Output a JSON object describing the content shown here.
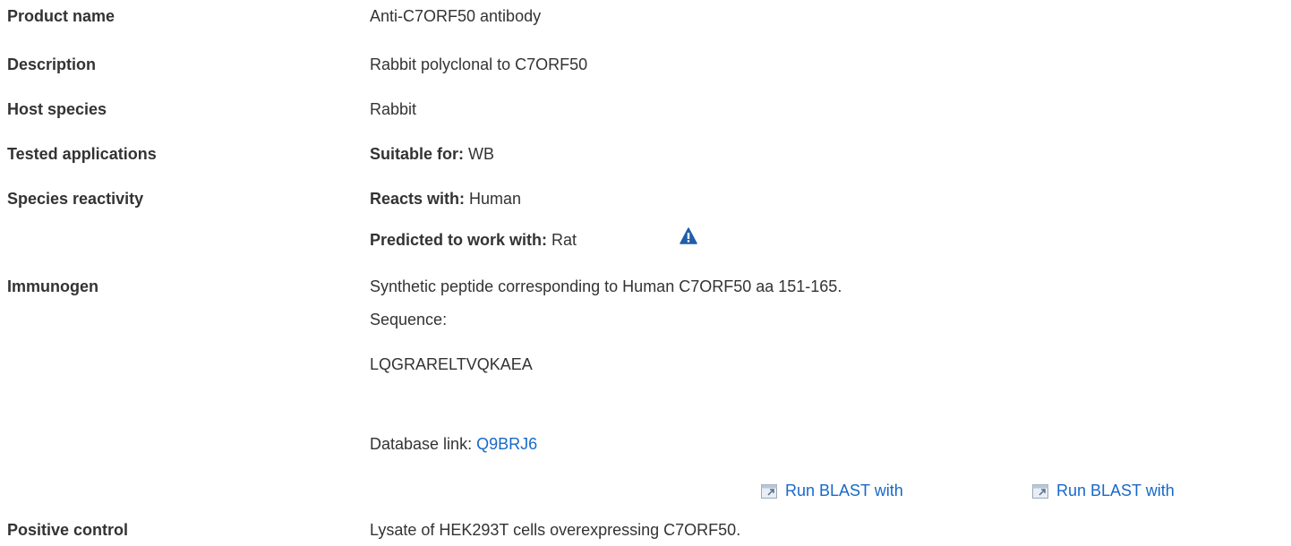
{
  "rows": {
    "product_name": {
      "label": "Product name",
      "value": "Anti-C7ORF50 antibody"
    },
    "description": {
      "label": "Description",
      "value": "Rabbit polyclonal to C7ORF50"
    },
    "host_species": {
      "label": "Host species",
      "value": "Rabbit"
    },
    "tested_applications": {
      "label": "Tested applications",
      "prefix": "Suitable for:",
      "value": "WB"
    },
    "species_reactivity": {
      "label": "Species reactivity",
      "reacts_prefix": "Reacts with:",
      "reacts_value": "Human",
      "predicted_prefix": "Predicted to work with:",
      "predicted_value": "Rat"
    },
    "immunogen": {
      "label": "Immunogen",
      "description": "Synthetic peptide corresponding to Human C7ORF50 aa 151-165.",
      "sequence_label": "Sequence:",
      "sequence": "LQGRARELTVQKAEA",
      "database_prefix": "Database link:",
      "database_link": "Q9BRJ6",
      "blast_1": "Run BLAST with",
      "blast_2": "Run BLAST with"
    },
    "positive_control": {
      "label": "Positive control",
      "value": "Lysate of HEK293T cells overexpressing C7ORF50."
    }
  },
  "icons": {
    "warning": "warning-triangle-icon",
    "blast": "external-window-icon"
  },
  "colors": {
    "link": "#1769c7",
    "text": "#333333",
    "warning": "#1f5fa8"
  }
}
